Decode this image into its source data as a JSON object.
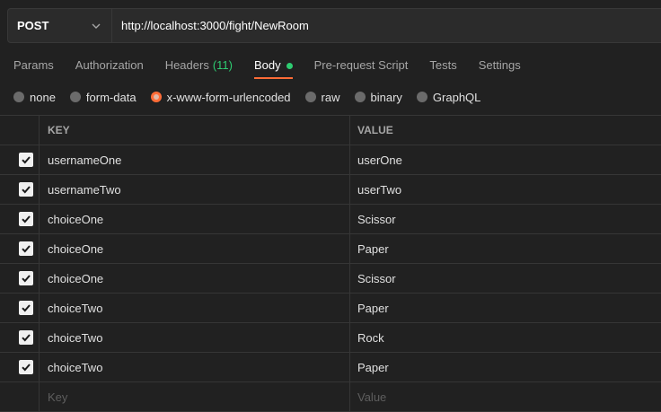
{
  "request": {
    "method": "POST",
    "url": "http://localhost:3000/fight/NewRoom"
  },
  "tabs": [
    {
      "label": "Params"
    },
    {
      "label": "Authorization"
    },
    {
      "label": "Headers",
      "count": "(11)"
    },
    {
      "label": "Body",
      "active": true
    },
    {
      "label": "Pre-request Script"
    },
    {
      "label": "Tests"
    },
    {
      "label": "Settings"
    }
  ],
  "body_types": [
    {
      "label": "none"
    },
    {
      "label": "form-data"
    },
    {
      "label": "x-www-form-urlencoded",
      "selected": true
    },
    {
      "label": "raw"
    },
    {
      "label": "binary"
    },
    {
      "label": "GraphQL"
    }
  ],
  "table": {
    "headers": {
      "key": "KEY",
      "value": "VALUE"
    },
    "rows": [
      {
        "key": "usernameOne",
        "value": "userOne",
        "checked": true
      },
      {
        "key": "usernameTwo",
        "value": "userTwo",
        "checked": true
      },
      {
        "key": "choiceOne",
        "value": "Scissor",
        "checked": true
      },
      {
        "key": "choiceOne",
        "value": "Paper",
        "checked": true
      },
      {
        "key": "choiceOne",
        "value": "Scissor",
        "checked": true
      },
      {
        "key": "choiceTwo",
        "value": "Paper",
        "checked": true
      },
      {
        "key": "choiceTwo",
        "value": "Rock",
        "checked": true
      },
      {
        "key": "choiceTwo",
        "value": "Paper",
        "checked": true
      }
    ],
    "placeholders": {
      "key": "Key",
      "value": "Value"
    }
  },
  "colors": {
    "accent": "#ff6c37",
    "status_green": "#2ecc71",
    "background": "#212121"
  }
}
